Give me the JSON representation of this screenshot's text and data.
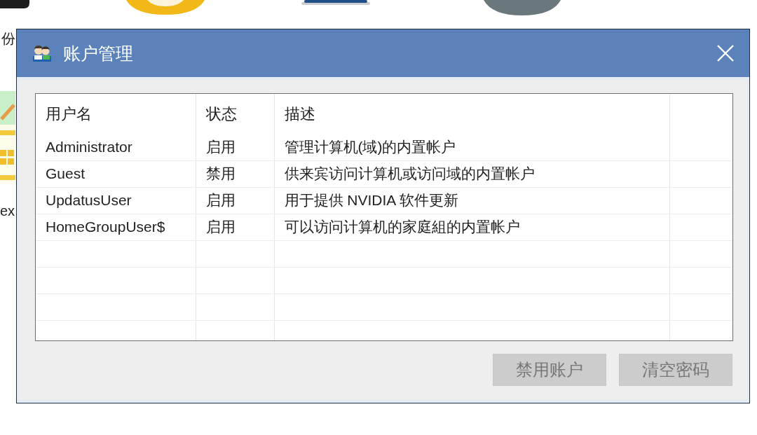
{
  "desktop": {
    "icon_labels": [
      "份",
      "ex"
    ]
  },
  "window": {
    "title": "账户管理"
  },
  "table": {
    "columns": [
      "用户名",
      "状态",
      "描述"
    ],
    "rows": [
      {
        "username": "Administrator",
        "status": "启用",
        "description": "管理计算机(域)的内置帐户"
      },
      {
        "username": "Guest",
        "status": "禁用",
        "description": "供来宾访问计算机或访问域的内置帐户"
      },
      {
        "username": "UpdatusUser",
        "status": "启用",
        "description": "用于提供 NVIDIA 软件更新"
      },
      {
        "username": "HomeGroupUser$",
        "status": "启用",
        "description": "可以访问计算机的家庭組的内置帐户"
      }
    ]
  },
  "buttons": [
    {
      "label": "禁用账户",
      "disabled": true
    },
    {
      "label": "清空密码",
      "disabled": true
    }
  ]
}
